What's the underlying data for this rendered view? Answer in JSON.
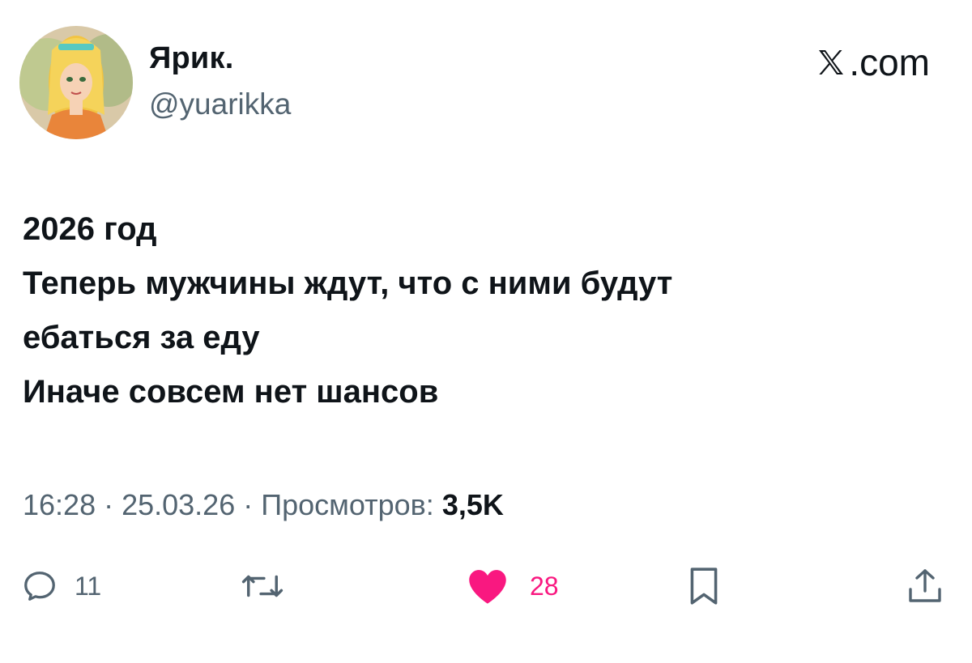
{
  "author": {
    "display_name": "Ярик.",
    "handle": "@yuarikka",
    "avatar": "avatar-image"
  },
  "source": {
    "site": ".com",
    "logo_icon": "x-logo-icon"
  },
  "tweet": {
    "lines": [
      "2026 год",
      "Теперь мужчины ждут, что с ними будут",
      "ебаться за еду",
      "Иначе совсем нет шансов"
    ],
    "time": "16:28",
    "date": "25.03.26",
    "separator": " · ",
    "views_label": "Просмотров:",
    "views_count": "3,5K"
  },
  "actions": {
    "reply": {
      "icon": "reply-icon",
      "count": "11"
    },
    "retweet": {
      "icon": "retweet-icon"
    },
    "like": {
      "icon": "heart-icon",
      "count": "28",
      "color": "#f91880"
    },
    "bookmark": {
      "icon": "bookmark-icon"
    },
    "share": {
      "icon": "share-icon"
    }
  },
  "colors": {
    "text_primary": "#0f1419",
    "text_secondary": "#536471",
    "like_accent": "#f91880"
  }
}
